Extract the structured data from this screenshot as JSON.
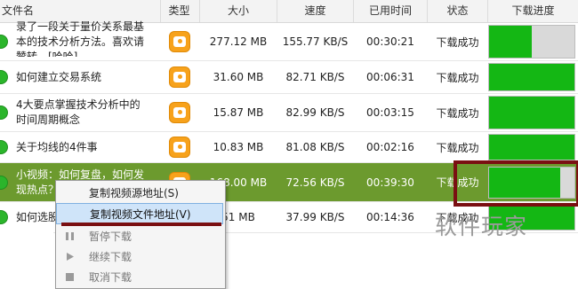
{
  "header": {
    "name": "文件名",
    "type": "类型",
    "size": "大小",
    "speed": "速度",
    "time": "已用时间",
    "status": "状态",
    "progress": "下载进度"
  },
  "rows": [
    {
      "line1": "录了一段关于量价关系最基",
      "line2": "本的技术分析方法。喜欢请",
      "line3": "赞转。[哈哈]",
      "size": "277.12 MB",
      "speed": "155.77 KB/S",
      "time": "00:30:21",
      "status": "下载成功",
      "progress": 0.5
    },
    {
      "line1": "如何建立交易系统",
      "size": "31.60 MB",
      "speed": "82.71 KB/S",
      "time": "00:06:31",
      "status": "下载成功",
      "progress": 1.0
    },
    {
      "line1": "4大要点掌握技术分析中的",
      "line2": "时间周期概念",
      "size": "15.87 MB",
      "speed": "82.99 KB/S",
      "time": "00:03:15",
      "status": "下载成功",
      "progress": 1.0
    },
    {
      "line1": "关于均线的4件事",
      "size": "10.83 MB",
      "speed": "81.08 KB/S",
      "time": "00:02:16",
      "status": "下载成功",
      "progress": 1.0
    },
    {
      "line1": "小视频：如何复盘，如何发",
      "line2": "现热点？",
      "size": "168.00 MB",
      "speed": "72.56 KB/S",
      "time": "00:39:30",
      "status": "下载成功",
      "progress": 0.83
    },
    {
      "line1": "如何选股",
      "size": "51 MB",
      "speed": "37.99 KB/S",
      "time": "00:14:36",
      "status": "下载成功",
      "progress": 1.0
    }
  ],
  "context_menu": {
    "copy_source": "复制视频源地址(S)",
    "copy_file": "复制视频文件地址(V)",
    "pause": "暂停下载",
    "resume": "继续下载",
    "cancel": "取消下载"
  },
  "watermark": "软件玩家",
  "colors": {
    "selected_row": "#6c9a2e",
    "progress_fill": "#14b714",
    "highlight_box": "#7a0f12",
    "video_icon": "#f7a21b"
  }
}
